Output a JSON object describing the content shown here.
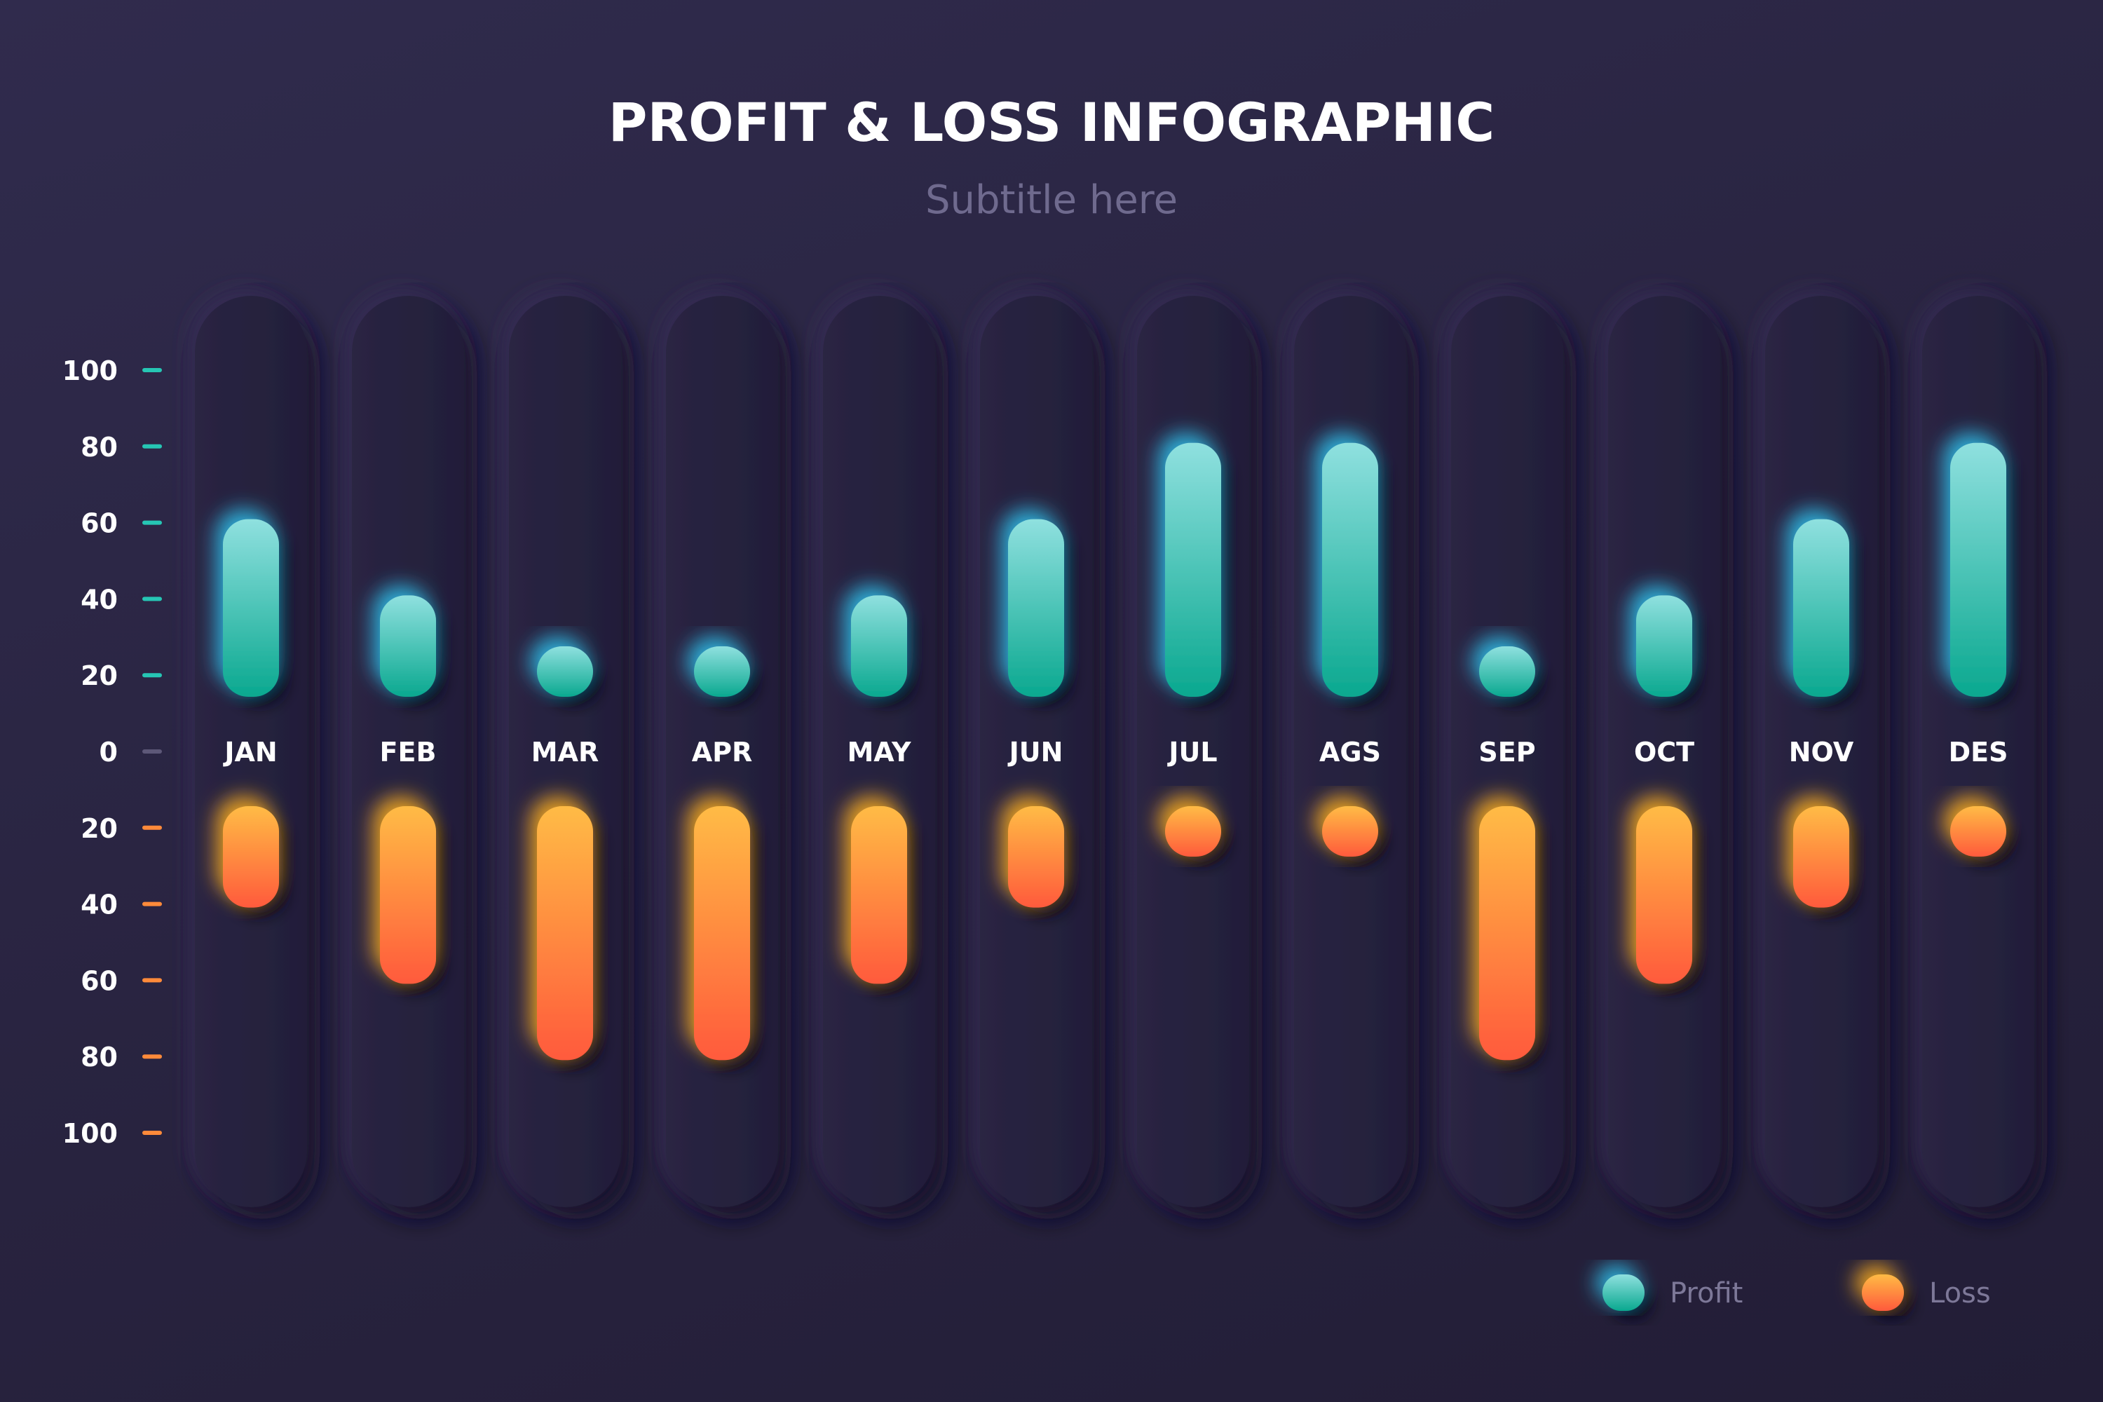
{
  "title": "PROFIT & LOSS INFOGRAPHIC",
  "subtitle": "Subtitle here",
  "chart_data": {
    "type": "bar",
    "title": "PROFIT & LOSS INFOGRAPHIC",
    "subtitle": "Subtitle here",
    "categories": [
      "JAN",
      "FEB",
      "MAR",
      "APR",
      "MAY",
      "JUN",
      "JUL",
      "AGS",
      "SEP",
      "OCT",
      "NOV",
      "DES"
    ],
    "series": [
      {
        "name": "Profit",
        "values": [
          60,
          40,
          20,
          20,
          40,
          60,
          80,
          80,
          20,
          40,
          60,
          80
        ],
        "color": "#18b8a4"
      },
      {
        "name": "Loss",
        "values": [
          40,
          60,
          80,
          80,
          60,
          40,
          20,
          20,
          80,
          60,
          40,
          20
        ],
        "color": "#ff8a3a"
      }
    ],
    "yticks_profit": [
      "100",
      "80",
      "60",
      "40",
      "20"
    ],
    "ytick_zero": "0",
    "yticks_loss": [
      "20",
      "40",
      "60",
      "80",
      "100"
    ],
    "ylim": [
      -100,
      100
    ],
    "legend": {
      "position": "bottom-right",
      "items": [
        "Profit",
        "Loss"
      ]
    },
    "colors": {
      "profit_top": "#8fe0df",
      "profit_bottom": "#0aa88f",
      "loss_top": "#ffbb45",
      "loss_bottom": "#ff5a3c",
      "track": "#26213d",
      "tick_zero": "#5d5878"
    }
  }
}
